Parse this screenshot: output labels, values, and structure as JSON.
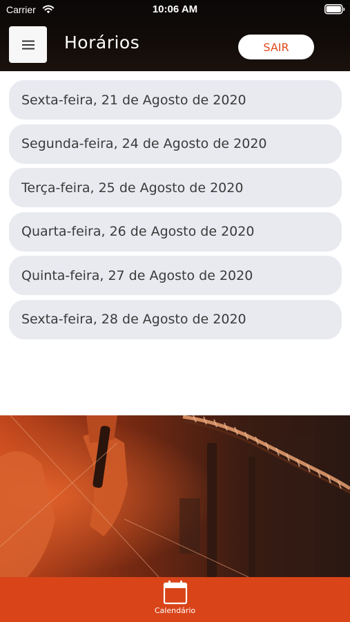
{
  "status_bar": {
    "carrier": "Carrier",
    "time": "10:06 AM"
  },
  "header": {
    "title": "Horários",
    "logout_label": "SAIR",
    "menu_icon": "hamburger-menu-icon"
  },
  "dates": [
    {
      "label": "Sexta-feira, 21 de Agosto de 2020"
    },
    {
      "label": "Segunda-feira, 24 de Agosto de 2020"
    },
    {
      "label": "Terça-feira, 25 de Agosto de 2020"
    },
    {
      "label": "Quarta-feira, 26 de Agosto de 2020"
    },
    {
      "label": "Quinta-feira, 27 de Agosto de 2020"
    },
    {
      "label": "Sexta-feira, 28 de Agosto de 2020"
    }
  ],
  "tab_bar": {
    "tabs": [
      {
        "label": "Calendário",
        "icon": "calendar-icon",
        "active": true
      }
    ]
  },
  "colors": {
    "accent": "#d94419",
    "logout_text": "#e04a1c",
    "header_bg": "#0a0807",
    "list_item_bg": "#e8eaf0"
  }
}
